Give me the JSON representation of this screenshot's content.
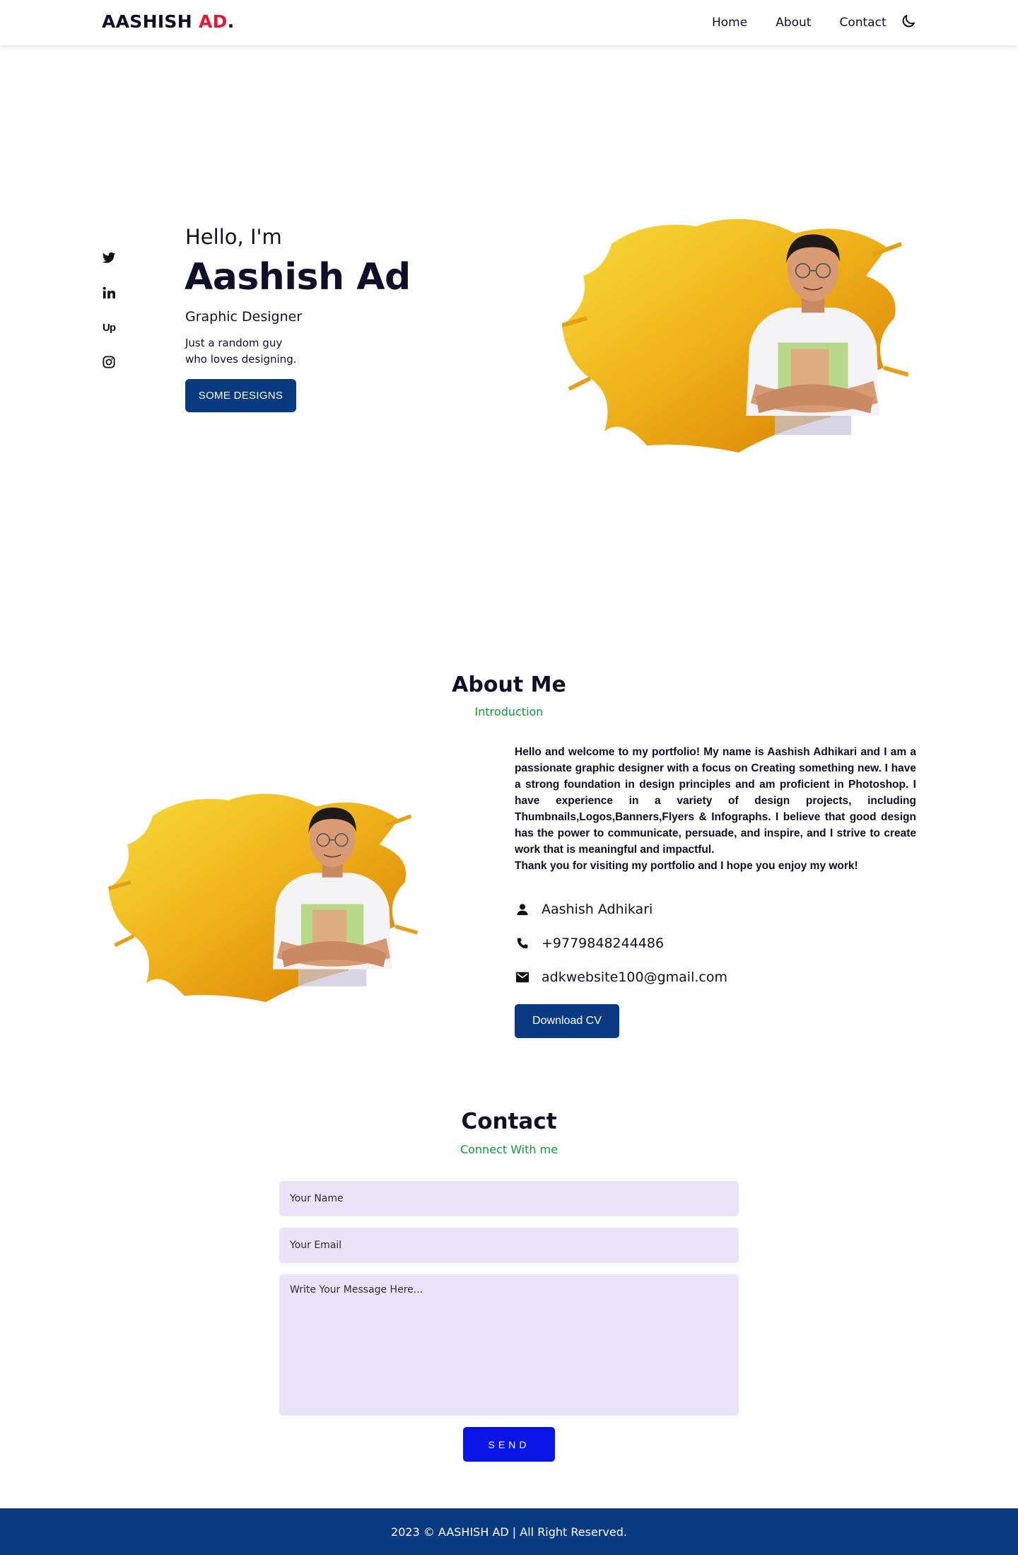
{
  "header": {
    "logo_main": "AASHISH",
    "logo_accent": "AD",
    "logo_dot": ".",
    "nav": [
      "Home",
      "About",
      "Contact"
    ],
    "theme_icon": "moon-icon"
  },
  "social": {
    "icons": [
      "twitter-icon",
      "linkedin-icon",
      "upwork-icon",
      "instagram-icon"
    ],
    "upwork_text": "Up"
  },
  "hero": {
    "greeting": "Hello, I'm",
    "name": "Aashish Ad",
    "role": "Graphic Designer",
    "desc_line1": "Just a random guy",
    "desc_line2": "who loves designing.",
    "button": "SOME DESIGNS"
  },
  "about": {
    "title": "About Me",
    "subtitle": "Introduction",
    "paragraph": "Hello and welcome to my portfolio! My name is Aashish Adhikari and I am a passionate graphic designer with a focus on Creating something new. I have a strong foundation in design principles and am proficient in Photoshop. I have experience in a variety of design projects, including Thumbnails,Logos,Banners,Flyers & Infographs. I believe that good design has the power to communicate, persuade, and inspire, and I strive to create work that is meaningful and impactful.",
    "thanks": "Thank you for visiting my portfolio and I hope you enjoy my work!",
    "name": "Aashish Adhikari",
    "phone": "+9779848244486",
    "email": "adkwebsite100@gmail.com",
    "button": "Download CV"
  },
  "contact": {
    "title": "Contact",
    "subtitle": "Connect With me",
    "name_placeholder": "Your Name",
    "email_placeholder": "Your Email",
    "message_placeholder": "Write Your Message Here...",
    "button": "SEND"
  },
  "footer": {
    "text": "2023 © AASHISH AD | All Right Reserved."
  },
  "colors": {
    "brand_blue": "#0a3a82",
    "accent_red": "#e4173b",
    "accent_green": "#0a9b3c",
    "send_blue": "#0a14e6",
    "field_bg": "#ebe4f9"
  }
}
